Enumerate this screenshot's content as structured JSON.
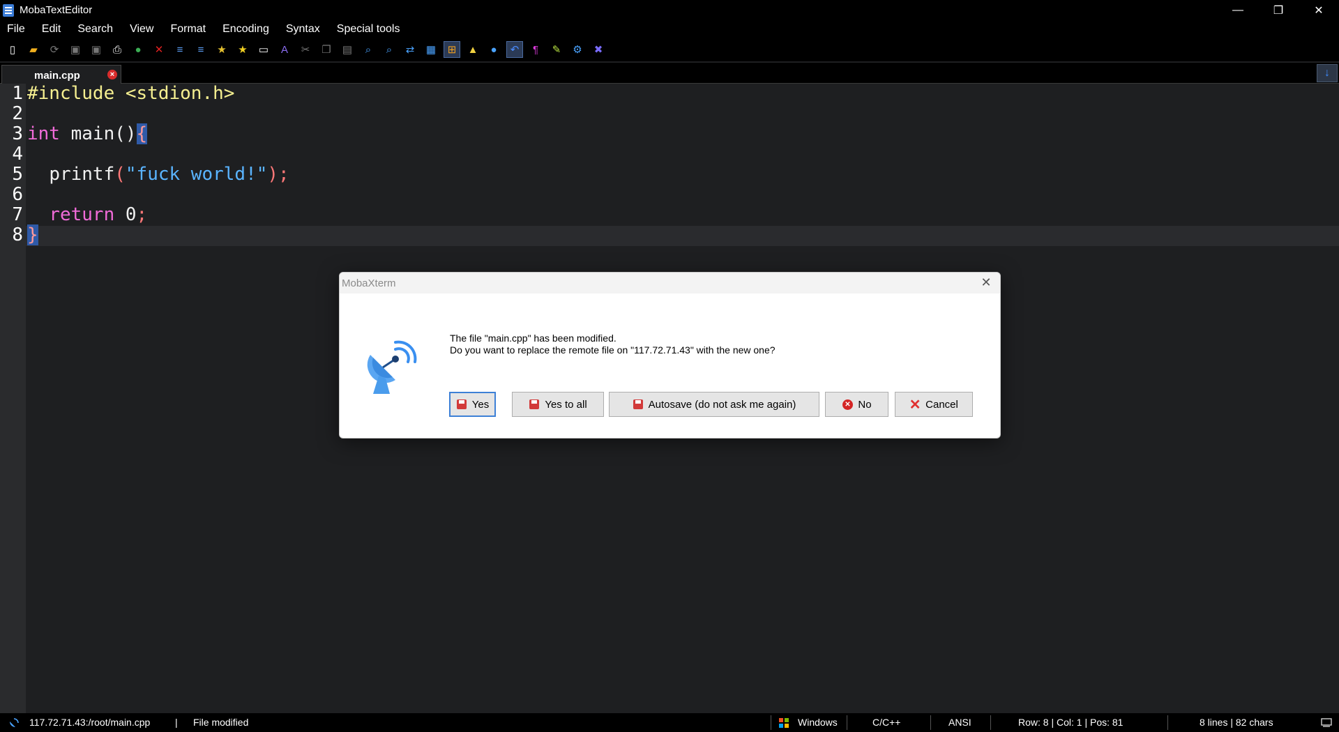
{
  "window": {
    "title": "MobaTextEditor",
    "controls": {
      "minimize": "—",
      "restore": "❐",
      "close": "✕"
    }
  },
  "menu": [
    "File",
    "Edit",
    "Search",
    "View",
    "Format",
    "Encoding",
    "Syntax",
    "Special tools"
  ],
  "toolbar": [
    {
      "name": "new-file-icon",
      "glyph": "▯",
      "color": "#ffffff"
    },
    {
      "name": "open-folder-icon",
      "glyph": "▰",
      "color": "#f2b01e"
    },
    {
      "name": "reload-icon",
      "glyph": "⟳",
      "color": "#777777"
    },
    {
      "name": "save-icon",
      "glyph": "▣",
      "color": "#777777"
    },
    {
      "name": "save-all-icon",
      "glyph": "▣",
      "color": "#777777"
    },
    {
      "name": "print-icon",
      "glyph": "⎙",
      "color": "#ffffff"
    },
    {
      "name": "web-icon",
      "glyph": "●",
      "color": "#3cae55"
    },
    {
      "name": "close-file-icon",
      "glyph": "✕",
      "color": "#e02020"
    },
    {
      "name": "unindent-icon",
      "glyph": "≡",
      "color": "#5a9bf0"
    },
    {
      "name": "indent-icon",
      "glyph": "≡",
      "color": "#5a9bf0"
    },
    {
      "name": "bookmark-icon",
      "glyph": "★",
      "color": "#e6c230"
    },
    {
      "name": "bookmark-next-icon",
      "glyph": "★",
      "color": "#f2d022"
    },
    {
      "name": "monitor-icon",
      "glyph": "▭",
      "color": "#ffffff"
    },
    {
      "name": "font-icon",
      "glyph": "A",
      "color": "#8a6cf0"
    },
    {
      "name": "cut-icon",
      "glyph": "✂",
      "color": "#777777"
    },
    {
      "name": "copy-icon",
      "glyph": "❐",
      "color": "#777777"
    },
    {
      "name": "paste-icon",
      "glyph": "▤",
      "color": "#777777"
    },
    {
      "name": "find-icon",
      "glyph": "⌕",
      "color": "#4aa3ff"
    },
    {
      "name": "find-next-icon",
      "glyph": "⌕",
      "color": "#4aa3ff"
    },
    {
      "name": "replace-icon",
      "glyph": "⇄",
      "color": "#4aa3ff"
    },
    {
      "name": "compare-icon",
      "glyph": "▦",
      "color": "#4aa3ff"
    },
    {
      "name": "windows-eol-icon",
      "glyph": "⊞",
      "color": "#f0a020"
    },
    {
      "name": "linux-eol-icon",
      "glyph": "▲",
      "color": "#f0d040"
    },
    {
      "name": "mac-eol-icon",
      "glyph": "●",
      "color": "#4aa3ff"
    },
    {
      "name": "word-wrap-icon",
      "glyph": "↶",
      "color": "#4a8cff"
    },
    {
      "name": "show-symbols-icon",
      "glyph": "¶",
      "color": "#d83ad8"
    },
    {
      "name": "highlight-icon",
      "glyph": "✎",
      "color": "#b6e040"
    },
    {
      "name": "settings-icon",
      "glyph": "⚙",
      "color": "#4aa3ff"
    },
    {
      "name": "exit-icon",
      "glyph": "✖",
      "color": "#7a6cff"
    }
  ],
  "tab": {
    "label": "main.cpp",
    "close_glyph": "×"
  },
  "scroll_button_glyph": "↓",
  "editor": {
    "line_numbers": [
      "1",
      "2",
      "3",
      "4",
      "5",
      "6",
      "7",
      "8"
    ],
    "code": {
      "line1": "#include <stdion.h>",
      "line3_kw": "int",
      "line3_fn": " main()",
      "line3_brace": "{",
      "line5_indent": "  ",
      "line5_fn": "printf",
      "line5_open": "(",
      "line5_str": "\"fuck world!\"",
      "line5_close": ");",
      "line7_indent": "  ",
      "line7_kw": "return",
      "line7_num": " 0",
      "line7_semi": ";",
      "line8_brace": "}"
    }
  },
  "dialog": {
    "title": "MobaXterm",
    "close_glyph": "✕",
    "message_line1": "The file \"main.cpp\" has been modified.",
    "message_line2": "Do you want to replace the remote file on \"117.72.71.43\" with the new one?",
    "buttons": {
      "yes": "Yes",
      "yes_to_all": "Yes to all",
      "autosave": "Autosave (do not ask me again)",
      "no": "No",
      "cancel": "Cancel"
    },
    "no_icon_glyph": "✕",
    "cancel_icon_glyph": "✕"
  },
  "statusbar": {
    "path": "117.72.71.43:/root/main.cpp",
    "separator": "|",
    "state": "File modified",
    "eol": "Windows",
    "syntax": "C/C++",
    "encoding": "ANSI",
    "position": "Row: 8 | Col: 1 | Pos: 81",
    "stats": "8 lines | 82 chars"
  }
}
